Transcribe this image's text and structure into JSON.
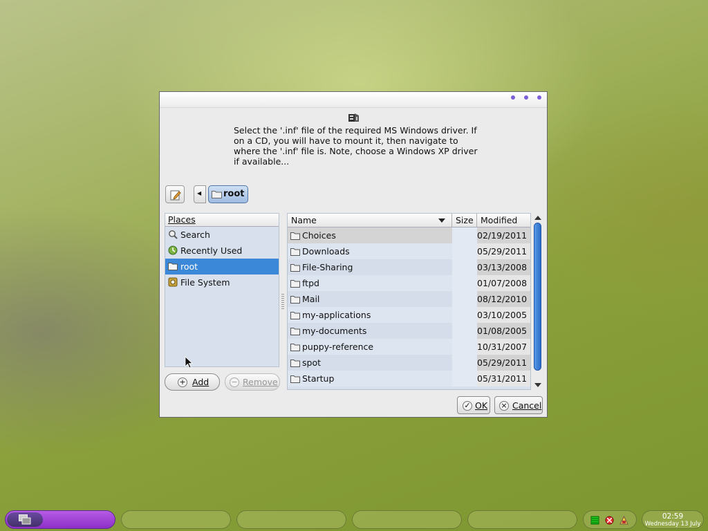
{
  "dialog": {
    "message": "Select the '.inf' file of the required MS Windows driver. If on a CD, you will have to mount it, then navigate to where the '.inf' file is. Note, choose a Windows XP driver if available...",
    "breadcrumb": "root",
    "places_header": "Places",
    "places": [
      {
        "label": "Search",
        "icon": "search-icon"
      },
      {
        "label": "Recently Used",
        "icon": "recent-icon"
      },
      {
        "label": "root",
        "icon": "folder-icon",
        "selected": true
      },
      {
        "label": "File System",
        "icon": "drive-icon"
      }
    ],
    "add_label": "Add",
    "remove_label": "Remove",
    "columns": {
      "name": "Name",
      "size": "Size",
      "modified": "Modified"
    },
    "files": [
      {
        "name": "Choices",
        "size": "",
        "modified": "02/19/2011"
      },
      {
        "name": "Downloads",
        "size": "",
        "modified": "05/29/2011"
      },
      {
        "name": "File-Sharing",
        "size": "",
        "modified": "03/13/2008"
      },
      {
        "name": "ftpd",
        "size": "",
        "modified": "01/07/2008"
      },
      {
        "name": "Mail",
        "size": "",
        "modified": "08/12/2010"
      },
      {
        "name": "my-applications",
        "size": "",
        "modified": "03/10/2005"
      },
      {
        "name": "my-documents",
        "size": "",
        "modified": "01/08/2005"
      },
      {
        "name": "puppy-reference",
        "size": "",
        "modified": "10/31/2007"
      },
      {
        "name": "spot",
        "size": "",
        "modified": "05/29/2011"
      },
      {
        "name": "Startup",
        "size": "",
        "modified": "05/31/2011"
      }
    ],
    "ok_label": "OK",
    "cancel_label": "Cancel",
    "colors": {
      "selection": "#3b88d8",
      "accent": "#7a5fd6"
    }
  },
  "taskbar": {
    "clock_time": "02:59",
    "clock_date": "Wednesday 13 July",
    "start_color": "#9a3fd4"
  }
}
